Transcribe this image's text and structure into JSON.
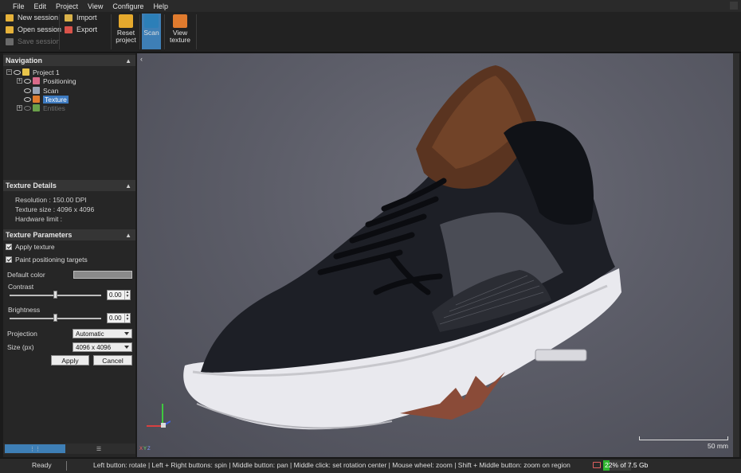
{
  "menubar": {
    "items": [
      "File",
      "Edit",
      "Project",
      "View",
      "Configure",
      "Help"
    ]
  },
  "toolbar": {
    "session": [
      {
        "label": "New session",
        "icon": "new-session-icon",
        "color": "#e6b23a"
      },
      {
        "label": "Open session",
        "icon": "folder-icon",
        "color": "#e6b23a"
      },
      {
        "label": "Save session",
        "icon": "save-icon",
        "color": "#6a6a6a"
      }
    ],
    "io": [
      {
        "label": "Import",
        "icon": "import-icon",
        "color": "#d9b24a"
      },
      {
        "label": "Export",
        "icon": "export-icon",
        "color": "#d9534a"
      }
    ],
    "reset": {
      "line1": "Reset",
      "line2": "project"
    },
    "scan": {
      "label": "Scan"
    },
    "view_texture": {
      "line1": "View",
      "line2": "texture"
    }
  },
  "navigation": {
    "title": "Navigation",
    "tree": [
      {
        "label": "Project 1"
      },
      {
        "label": "Positioning"
      },
      {
        "label": "Scan"
      },
      {
        "label": "Texture"
      },
      {
        "label": "Entities"
      }
    ]
  },
  "texture_details": {
    "title": "Texture Details",
    "lines": [
      "Resolution : 150.00 DPI",
      "Texture size : 4096 x 4096",
      "Hardware limit :"
    ]
  },
  "texture_params": {
    "title": "Texture Parameters",
    "apply_texture": "Apply texture",
    "paint_targets": "Paint positioning targets",
    "default_color_label": "Default color",
    "default_color": "#8a8a8a",
    "contrast_label": "Contrast",
    "contrast_value": "0.00",
    "contrast_level": 0.5,
    "brightness_label": "Brightness",
    "brightness_value": "0.00",
    "brightness_level": 0.5,
    "projection_label": "Projection",
    "projection_value": "Automatic",
    "size_label": "Size (px)",
    "size_value": "4096 x 4096",
    "apply_button": "Apply",
    "cancel_button": "Cancel"
  },
  "viewport": {
    "collapse_glyph": "‹",
    "scale_label": "50 mm",
    "axis_x": "X",
    "axis_y": "Y",
    "axis_z": "Z"
  },
  "statusbar": {
    "ready": "Ready",
    "hint": "Left button: rotate  |  Left + Right buttons: spin  |  Middle button: pan  |  Middle click: set rotation center  |  Mouse wheel: zoom  |  Shift + Middle button: zoom on region",
    "memory_text": "22% of 7.5 Gb",
    "memory_fraction": 0.22,
    "memory_color": "#2fb52f"
  }
}
